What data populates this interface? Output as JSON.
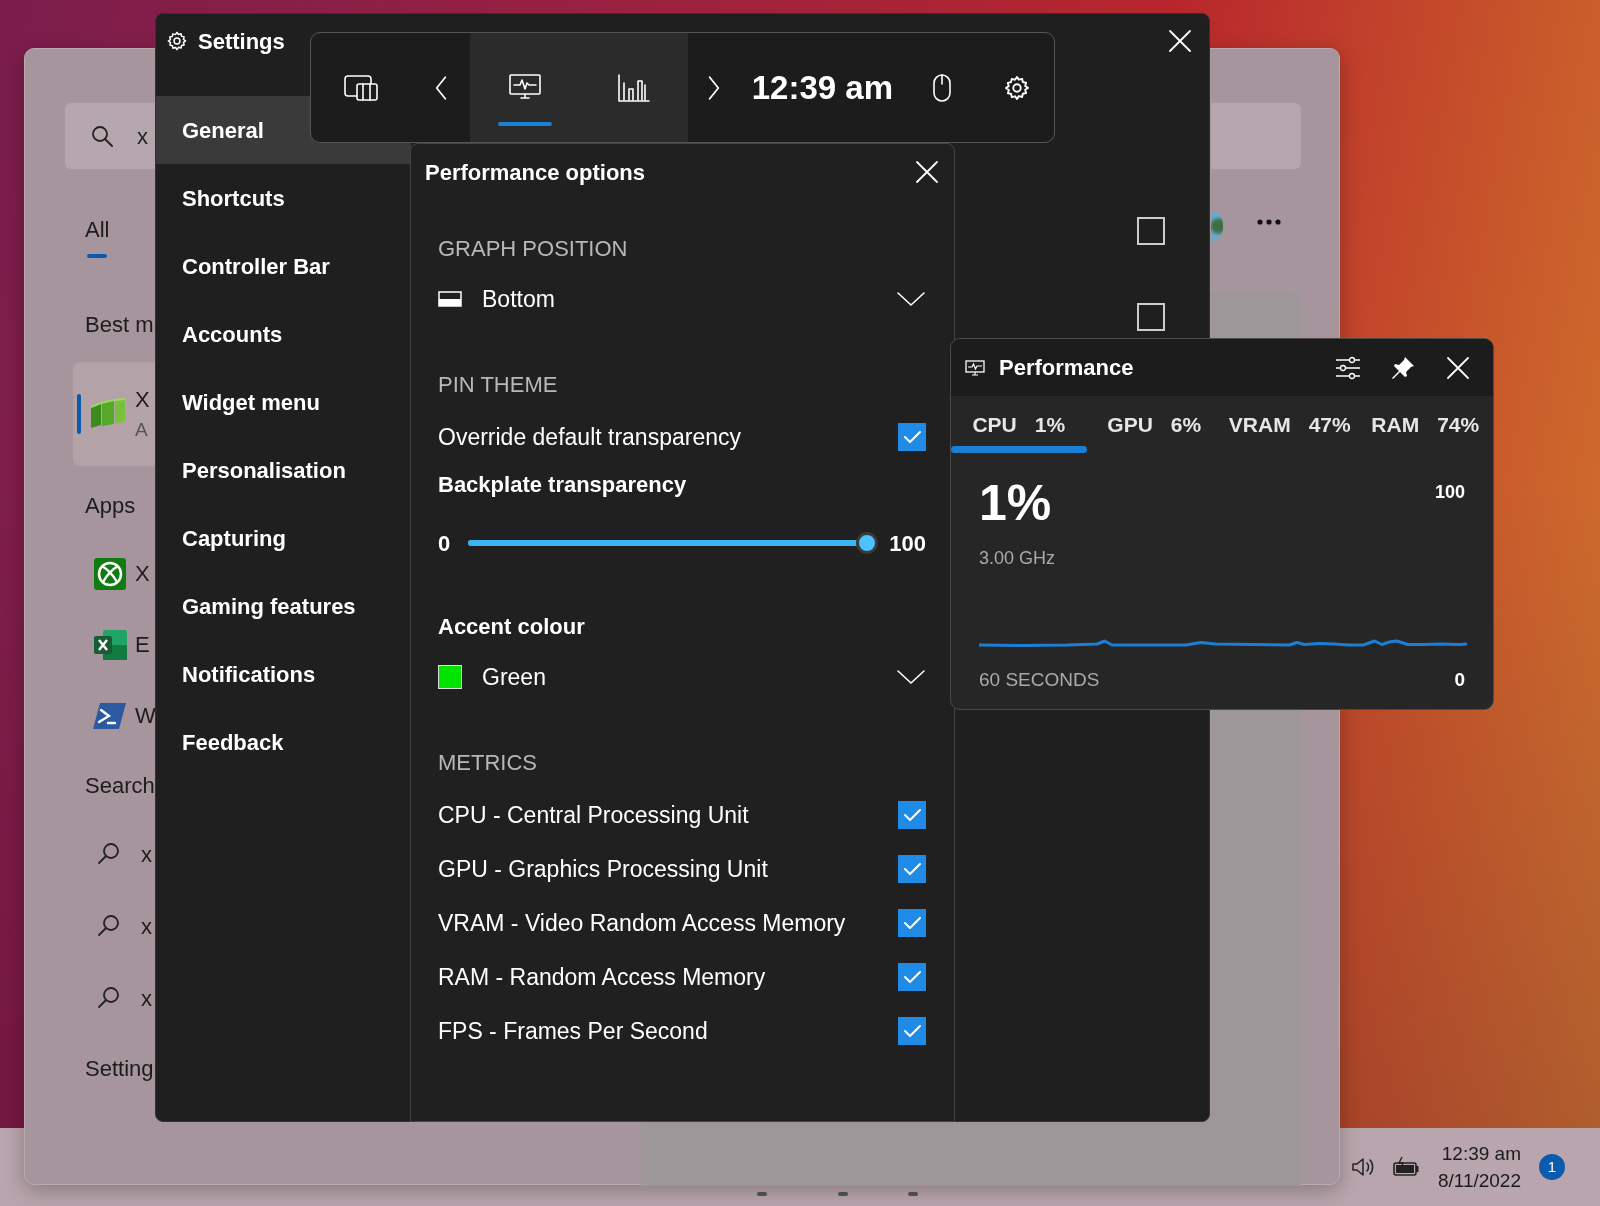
{
  "start_menu": {
    "search": {
      "value": "x"
    },
    "tabs": [
      {
        "label": "All",
        "selected": true
      }
    ],
    "best_match_heading": "Best m",
    "best_match": {
      "title": "X",
      "subtitle": "A",
      "selected": true
    },
    "apps_heading": "Apps",
    "apps": [
      {
        "kind": "xbox",
        "name": "X"
      },
      {
        "kind": "excel",
        "name": "E"
      },
      {
        "kind": "powershell",
        "name": "W"
      }
    ],
    "search_heading": "Search",
    "search_results": [
      "x",
      "x",
      "x"
    ],
    "settings_heading": "Setting"
  },
  "settings": {
    "title": "Settings",
    "nav": [
      {
        "label": "General",
        "selected": true
      },
      {
        "label": "Shortcuts",
        "selected": false
      },
      {
        "label": "Controller Bar",
        "selected": false
      },
      {
        "label": "Accounts",
        "selected": false
      },
      {
        "label": "Widget menu",
        "selected": false
      },
      {
        "label": "Personalisation",
        "selected": false
      },
      {
        "label": "Capturing",
        "selected": false
      },
      {
        "label": "Gaming features",
        "selected": false
      },
      {
        "label": "Notifications",
        "selected": false
      },
      {
        "label": "Feedback",
        "selected": false
      }
    ],
    "options": [
      {
        "checked": false
      },
      {
        "checked": false
      }
    ]
  },
  "game_bar": {
    "widgets": [
      {
        "kind": "performance",
        "selected": true
      },
      {
        "kind": "resources",
        "selected": false
      }
    ],
    "time": "12:39 am"
  },
  "performance_options": {
    "title": "Performance options",
    "items": [
      {
        "kind": "heading",
        "text": "GRAPH POSITION"
      },
      {
        "kind": "dropdown",
        "value": "Bottom"
      },
      {
        "kind": "heading",
        "text": "PIN THEME"
      },
      {
        "kind": "checkbox",
        "label": "Override default transparency",
        "checked": true
      },
      {
        "kind": "label",
        "text": "Backplate transparency"
      },
      {
        "kind": "slider",
        "min": "0",
        "max": "100",
        "level": 1
      },
      {
        "kind": "label",
        "text": "Accent colour"
      },
      {
        "kind": "dropdown",
        "value": "Green",
        "color": "#00e400"
      },
      {
        "kind": "heading",
        "text": "METRICS"
      },
      {
        "kind": "checkbox",
        "label": "CPU - Central Processing Unit",
        "checked": true
      },
      {
        "kind": "checkbox",
        "label": "GPU - Graphics Processing Unit",
        "checked": true
      },
      {
        "kind": "checkbox",
        "label": "VRAM - Video Random Access Memory",
        "checked": true
      },
      {
        "kind": "checkbox",
        "label": "RAM - Random Access Memory",
        "checked": true
      },
      {
        "kind": "checkbox",
        "label": "FPS - Frames Per Second",
        "checked": true
      }
    ]
  },
  "performance_widget": {
    "title": "Performance",
    "tabs": [
      {
        "label": "CPU",
        "value": "1%",
        "selected": true
      },
      {
        "label": "GPU",
        "value": "6%",
        "selected": false
      },
      {
        "label": "VRAM",
        "value": "47%",
        "selected": false
      },
      {
        "label": "RAM",
        "value": "74%",
        "selected": false
      }
    ],
    "reading": "1%",
    "detail": "3.00 GHz",
    "scale_max": "100",
    "scale_min": "0",
    "time_span": "60 SECONDS"
  },
  "taskbar": {
    "time": "12:39 am",
    "date": "8/11/2022",
    "notification_count": "1"
  }
}
